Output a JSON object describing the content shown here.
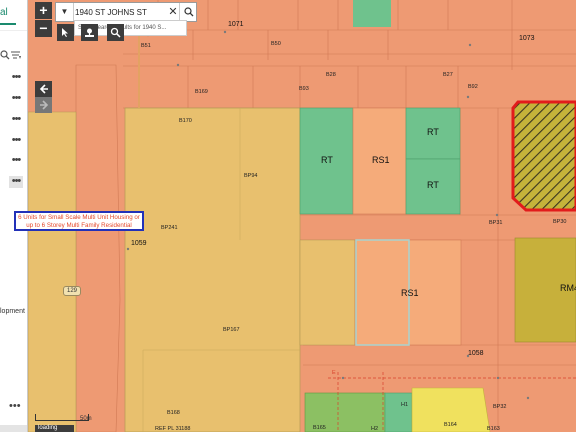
{
  "search": {
    "value": "1940 ST JOHNS ST",
    "hint": "Show search results for 1940 S...",
    "toggle_glyph": "▼",
    "clear_glyph": "✕",
    "go_icon": "search-icon"
  },
  "sidebar": {
    "tab_label": "al",
    "text": "lopment",
    "item_count": 6,
    "selected_index": 5,
    "menu_glyph": "•••"
  },
  "map": {
    "zoom_in": "+",
    "zoom_out": "−",
    "annotation_line1": "6 Units for Small Scale Multi Unit Housing or",
    "annotation_line2": "up to 6 Storey Multi Family Residential",
    "scale_label": "50m",
    "loading_label": "loading",
    "route_shield": "129",
    "numbers": {
      "n1071": "1071",
      "n1073": "1073",
      "n1059": "1059",
      "n1058": "1058"
    },
    "parcels": {
      "b51": "B51",
      "b50": "B50",
      "b28": "B28",
      "b27": "B27",
      "b93": "B93",
      "b92": "B92",
      "b169": "B169",
      "b170": "B170",
      "bp94": "BP94",
      "bp241": "BP241",
      "bp167": "BP167",
      "b168": "B168",
      "bp31": "BP31",
      "bp30": "BP30",
      "b165": "B165",
      "b164": "B164",
      "b163": "B163",
      "bp32": "BP32",
      "refpl": "REF PL 31188",
      "h1": "H1",
      "h2": "H2",
      "e": "E"
    },
    "zones": {
      "rt1": "RT",
      "rs1a": "RS1",
      "rt2": "RT",
      "rt3": "RT",
      "rs1b": "RS1",
      "rm4": "RM4"
    },
    "colors": {
      "orange": "#ee9a73",
      "tan": "#e8c06e",
      "green": "#6fc28d",
      "light_orange": "#f5ab7a",
      "olive": "#c7b03b",
      "yellow": "#f0e15e",
      "lime": "#8cc063",
      "hatch_border": "#e21b1b"
    }
  }
}
